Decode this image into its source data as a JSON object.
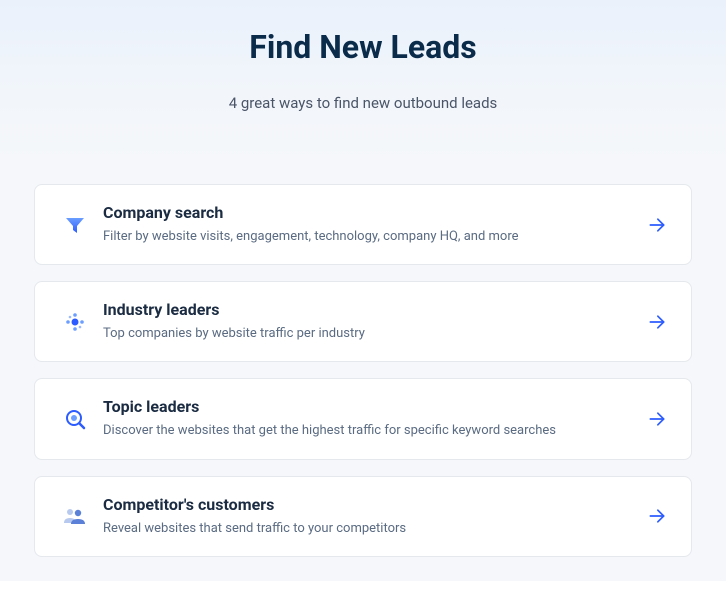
{
  "hero": {
    "title": "Find New Leads",
    "subtitle": "4 great ways to find new outbound leads"
  },
  "cards": [
    {
      "icon": "funnel-icon",
      "title": "Company search",
      "description": "Filter by website visits, engagement, technology, company HQ, and more"
    },
    {
      "icon": "network-icon",
      "title": "Industry leaders",
      "description": "Top companies by website traffic per industry"
    },
    {
      "icon": "magnify-icon",
      "title": "Topic leaders",
      "description": "Discover the websites that get the highest traffic for specific keyword searches"
    },
    {
      "icon": "users-icon",
      "title": "Competitor's customers",
      "description": "Reveal websites that send traffic to your competitors"
    }
  ]
}
